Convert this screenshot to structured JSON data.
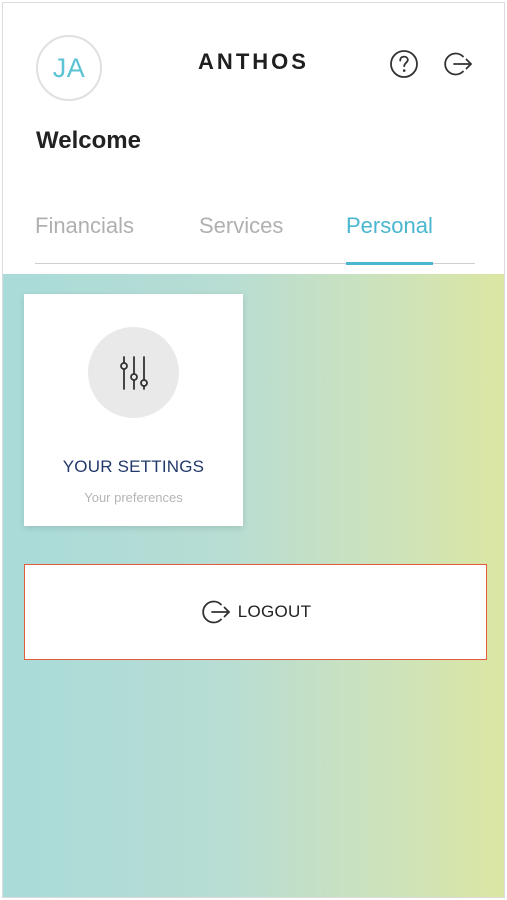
{
  "header": {
    "avatar_initials": "JA",
    "brand": "ANTHOS",
    "help_icon": "question-circle-icon",
    "logout_icon": "logout-arrow-icon",
    "welcome": "Welcome"
  },
  "tabs": [
    {
      "label": "Financials",
      "active": false
    },
    {
      "label": "Services",
      "active": false
    },
    {
      "label": "Personal",
      "active": true
    }
  ],
  "settings_card": {
    "icon": "sliders-icon",
    "title": "YOUR SETTINGS",
    "subtitle": "Your preferences"
  },
  "logout_bar": {
    "icon": "logout-arrow-icon",
    "label": "LOGOUT"
  },
  "colors": {
    "accent": "#4ab6cf",
    "card_title": "#23386b",
    "logout_border": "#e25d3d",
    "gradient_start": "#a9dbd9",
    "gradient_end": "#dbe6a3"
  }
}
